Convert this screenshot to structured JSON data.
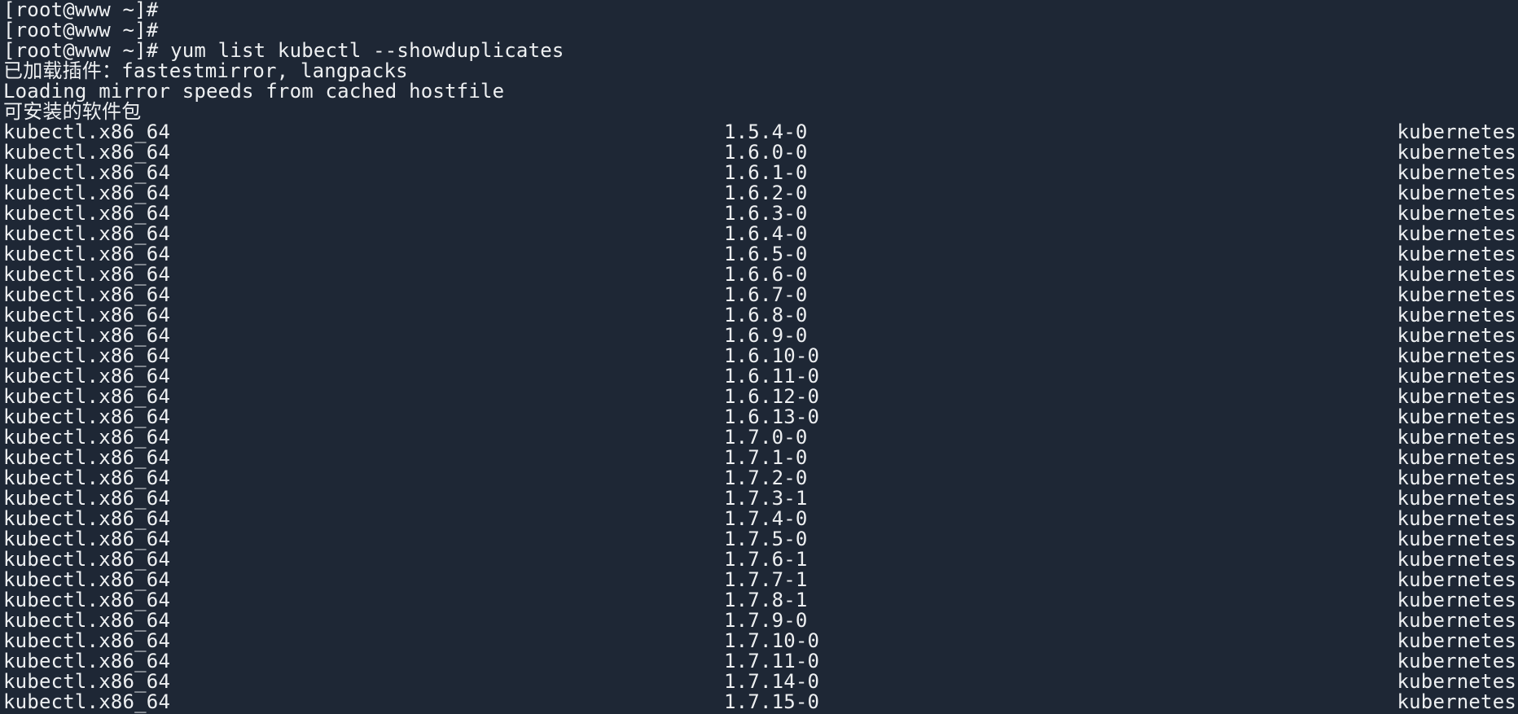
{
  "terminal": {
    "lines": [
      "[root@www ~]#",
      "[root@www ~]#",
      "[root@www ~]# yum list kubectl --showduplicates",
      "已加载插件：fastestmirror, langpacks",
      "Loading mirror speeds from cached hostfile",
      "可安装的软件包"
    ],
    "packages": [
      {
        "name": "kubectl.x86_64",
        "version": "1.5.4-0",
        "repo": "kubernetes"
      },
      {
        "name": "kubectl.x86_64",
        "version": "1.6.0-0",
        "repo": "kubernetes"
      },
      {
        "name": "kubectl.x86_64",
        "version": "1.6.1-0",
        "repo": "kubernetes"
      },
      {
        "name": "kubectl.x86_64",
        "version": "1.6.2-0",
        "repo": "kubernetes"
      },
      {
        "name": "kubectl.x86_64",
        "version": "1.6.3-0",
        "repo": "kubernetes"
      },
      {
        "name": "kubectl.x86_64",
        "version": "1.6.4-0",
        "repo": "kubernetes"
      },
      {
        "name": "kubectl.x86_64",
        "version": "1.6.5-0",
        "repo": "kubernetes"
      },
      {
        "name": "kubectl.x86_64",
        "version": "1.6.6-0",
        "repo": "kubernetes"
      },
      {
        "name": "kubectl.x86_64",
        "version": "1.6.7-0",
        "repo": "kubernetes"
      },
      {
        "name": "kubectl.x86_64",
        "version": "1.6.8-0",
        "repo": "kubernetes"
      },
      {
        "name": "kubectl.x86_64",
        "version": "1.6.9-0",
        "repo": "kubernetes"
      },
      {
        "name": "kubectl.x86_64",
        "version": "1.6.10-0",
        "repo": "kubernetes"
      },
      {
        "name": "kubectl.x86_64",
        "version": "1.6.11-0",
        "repo": "kubernetes"
      },
      {
        "name": "kubectl.x86_64",
        "version": "1.6.12-0",
        "repo": "kubernetes"
      },
      {
        "name": "kubectl.x86_64",
        "version": "1.6.13-0",
        "repo": "kubernetes"
      },
      {
        "name": "kubectl.x86_64",
        "version": "1.7.0-0",
        "repo": "kubernetes"
      },
      {
        "name": "kubectl.x86_64",
        "version": "1.7.1-0",
        "repo": "kubernetes"
      },
      {
        "name": "kubectl.x86_64",
        "version": "1.7.2-0",
        "repo": "kubernetes"
      },
      {
        "name": "kubectl.x86_64",
        "version": "1.7.3-1",
        "repo": "kubernetes"
      },
      {
        "name": "kubectl.x86_64",
        "version": "1.7.4-0",
        "repo": "kubernetes"
      },
      {
        "name": "kubectl.x86_64",
        "version": "1.7.5-0",
        "repo": "kubernetes"
      },
      {
        "name": "kubectl.x86_64",
        "version": "1.7.6-1",
        "repo": "kubernetes"
      },
      {
        "name": "kubectl.x86_64",
        "version": "1.7.7-1",
        "repo": "kubernetes"
      },
      {
        "name": "kubectl.x86_64",
        "version": "1.7.8-1",
        "repo": "kubernetes"
      },
      {
        "name": "kubectl.x86_64",
        "version": "1.7.9-0",
        "repo": "kubernetes"
      },
      {
        "name": "kubectl.x86_64",
        "version": "1.7.10-0",
        "repo": "kubernetes"
      },
      {
        "name": "kubectl.x86_64",
        "version": "1.7.11-0",
        "repo": "kubernetes"
      },
      {
        "name": "kubectl.x86_64",
        "version": "1.7.14-0",
        "repo": "kubernetes"
      },
      {
        "name": "kubectl.x86_64",
        "version": "1.7.15-0",
        "repo": "kubernetes"
      }
    ]
  }
}
